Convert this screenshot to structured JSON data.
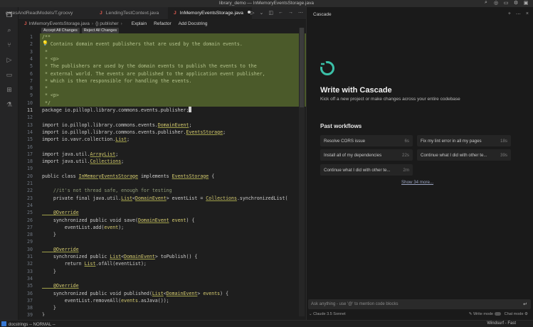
{
  "window": {
    "title": "library_demo — InMemoryEventsStorage.java"
  },
  "titlebar_icons": [
    "search-icon",
    "account-icon",
    "layout-icon",
    "settings-icon",
    "close-panel-icon"
  ],
  "activity_bar": [
    "explorer-icon",
    "search-icon",
    "source-control-icon",
    "run-debug-icon",
    "remote-icon",
    "extensions-icon",
    "testing-icon"
  ],
  "tabs": [
    {
      "label": "gatesAndReadModels/T.groovy",
      "active": false
    },
    {
      "label": "LendingTestContext.java",
      "active": false
    },
    {
      "label": "InMemoryEventsStorage.java",
      "active": true,
      "modified": true
    }
  ],
  "breadcrumb": {
    "file": "InMemoryEventsStorage.java",
    "symbol": "{} publisher",
    "actions": [
      "Explain",
      "Refactor",
      "Add Docstring"
    ]
  },
  "diff_actions": {
    "accept": "Accept All Changes",
    "reject": "Reject All Changes"
  },
  "code_lines": [
    {
      "n": "1",
      "segs": [
        [
          "c",
          "/**"
        ]
      ]
    },
    {
      "n": "2",
      "segs": [
        [
          "c",
          " * Contains domain event publishers that are used by the domain events."
        ]
      ]
    },
    {
      "n": "3",
      "segs": [
        [
          "c",
          " *"
        ]
      ]
    },
    {
      "n": "4",
      "segs": [
        [
          "c",
          " * <p>"
        ]
      ]
    },
    {
      "n": "5",
      "segs": [
        [
          "c",
          " * The publishers are used by the domain events to publish the events to the"
        ]
      ]
    },
    {
      "n": "6",
      "segs": [
        [
          "c",
          " * external world. The events are published to the application event publisher,"
        ]
      ]
    },
    {
      "n": "7",
      "segs": [
        [
          "c",
          " * which is then responsible for handling the events."
        ]
      ]
    },
    {
      "n": "8",
      "segs": [
        [
          "c",
          " *"
        ]
      ]
    },
    {
      "n": "9",
      "segs": [
        [
          "c",
          " * <p>"
        ]
      ]
    },
    {
      "n": "10",
      "segs": [
        [
          "c",
          " */"
        ]
      ]
    },
    {
      "n": "11",
      "segs": [
        [
          "kw",
          "package io.pillopl.library.commons.events.publisher;"
        ]
      ]
    },
    {
      "n": "12",
      "segs": []
    },
    {
      "n": "13",
      "segs": [
        [
          "kw",
          "import io.pillopl.library.commons.events."
        ],
        [
          "ty",
          "DomainEvent"
        ],
        [
          "kw",
          ";"
        ]
      ]
    },
    {
      "n": "14",
      "segs": [
        [
          "kw",
          "import io.pillopl.library.commons.events.publisher."
        ],
        [
          "ty",
          "EventsStorage"
        ],
        [
          "kw",
          ";"
        ]
      ]
    },
    {
      "n": "15",
      "segs": [
        [
          "kw",
          "import io.vavr.collection."
        ],
        [
          "ty",
          "List"
        ],
        [
          "kw",
          ";"
        ]
      ]
    },
    {
      "n": "16",
      "segs": []
    },
    {
      "n": "17",
      "segs": [
        [
          "kw",
          "import java.util."
        ],
        [
          "ty",
          "ArrayList"
        ],
        [
          "kw",
          ";"
        ]
      ]
    },
    {
      "n": "18",
      "segs": [
        [
          "kw",
          "import java.util."
        ],
        [
          "ty",
          "Collections"
        ],
        [
          "kw",
          ";"
        ]
      ]
    },
    {
      "n": "19",
      "segs": []
    },
    {
      "n": "20",
      "segs": [
        [
          "kw",
          "public class "
        ],
        [
          "ty",
          "InMemoryEventsStorage"
        ],
        [
          "kw",
          " implements "
        ],
        [
          "ty",
          "EventsStorage"
        ],
        [
          "kw",
          " {"
        ]
      ]
    },
    {
      "n": "21",
      "segs": []
    },
    {
      "n": "22",
      "segs": [
        [
          "cm",
          "    //it's not thread safe, enough for testing"
        ]
      ]
    },
    {
      "n": "23",
      "segs": [
        [
          "kw",
          "    private final java.util."
        ],
        [
          "ty",
          "List"
        ],
        [
          "kw",
          "<"
        ],
        [
          "ty",
          "DomainEvent"
        ],
        [
          "kw",
          "> eventList = "
        ],
        [
          "ty",
          "Collections"
        ],
        [
          "kw",
          ".synchronizedList("
        ]
      ]
    },
    {
      "n": "24",
      "segs": []
    },
    {
      "n": "25",
      "segs": [
        [
          "an",
          "    @Override"
        ]
      ]
    },
    {
      "n": "26",
      "segs": [
        [
          "kw",
          "    synchronized public void save("
        ],
        [
          "ty",
          "DomainEvent"
        ],
        [
          "kw",
          " "
        ],
        [
          "pm",
          "event"
        ],
        [
          "kw",
          ") {"
        ]
      ]
    },
    {
      "n": "27",
      "segs": [
        [
          "kw",
          "        eventList.add("
        ],
        [
          "pm",
          "event"
        ],
        [
          "kw",
          ");"
        ]
      ]
    },
    {
      "n": "28",
      "segs": [
        [
          "kw",
          "    }"
        ]
      ]
    },
    {
      "n": "29",
      "segs": []
    },
    {
      "n": "30",
      "segs": [
        [
          "an",
          "    @Override"
        ]
      ]
    },
    {
      "n": "31",
      "segs": [
        [
          "kw",
          "    synchronized public "
        ],
        [
          "ty",
          "List"
        ],
        [
          "kw",
          "<"
        ],
        [
          "ty",
          "DomainEvent"
        ],
        [
          "kw",
          "> toPublish() {"
        ]
      ]
    },
    {
      "n": "32",
      "segs": [
        [
          "kw",
          "        return "
        ],
        [
          "ty",
          "List"
        ],
        [
          "kw",
          ".ofAll(eventList);"
        ]
      ]
    },
    {
      "n": "33",
      "segs": [
        [
          "kw",
          "    }"
        ]
      ]
    },
    {
      "n": "34",
      "segs": []
    },
    {
      "n": "35",
      "segs": [
        [
          "an",
          "    @Override"
        ]
      ]
    },
    {
      "n": "36",
      "segs": [
        [
          "kw",
          "    synchronized public void published("
        ],
        [
          "ty",
          "List"
        ],
        [
          "kw",
          "<"
        ],
        [
          "ty",
          "DomainEvent"
        ],
        [
          "kw",
          "> "
        ],
        [
          "pm",
          "events"
        ],
        [
          "kw",
          ") {"
        ]
      ]
    },
    {
      "n": "37",
      "segs": [
        [
          "kw",
          "        eventList.removeAll("
        ],
        [
          "pm",
          "events"
        ],
        [
          "kw",
          ".asJava());"
        ]
      ]
    },
    {
      "n": "38",
      "segs": [
        [
          "kw",
          "    }"
        ]
      ]
    },
    {
      "n": "39",
      "segs": [
        [
          "kw",
          "}"
        ]
      ]
    }
  ],
  "cascade": {
    "panel_title": "Cascade",
    "headline": "Write with Cascade",
    "subline": "Kick off a new project or make changes across your entire codebase",
    "past_workflows_title": "Past workflows",
    "workflows": [
      {
        "label": "Resolve CORS issue",
        "time": "6s"
      },
      {
        "label": "Fix my lint error in all my pages",
        "time": "18s"
      },
      {
        "label": "Install all of my dependencies",
        "time": "22s"
      },
      {
        "label": "Continue what I did with other te...",
        "time": "39s"
      },
      {
        "label": "Continue what I did with other te...",
        "time": "2m"
      }
    ],
    "show_more": "Show 34 more...",
    "chat_placeholder": "Ask anything - use '@' to mention code blocks",
    "model": "Claude 3.5 Sonnet",
    "write_mode": "Write mode",
    "chat_mode": "Chat mode"
  },
  "status": {
    "left": "docstrings  -- NORMAL --",
    "right": "Windsurf - Fast"
  },
  "colors": {
    "highlight": "#4b5a2a",
    "accent": "#3bc0a8",
    "java_icon": "#e05a4f"
  }
}
